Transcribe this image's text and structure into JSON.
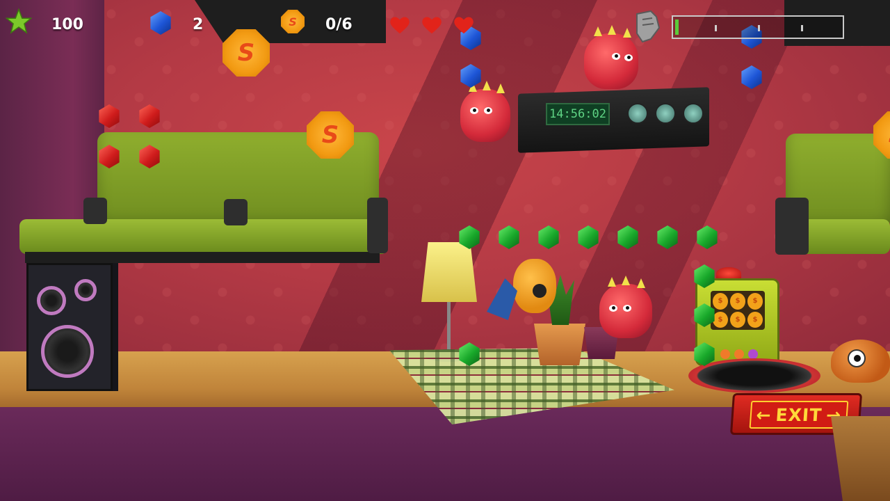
{
  "hud": {
    "score": "100",
    "blue_gems": "2",
    "coins": "0/6",
    "hearts": 3,
    "level_progress": 0.02
  },
  "device": {
    "clock_display": "14:56:02"
  },
  "exit": {
    "label": "EXIT",
    "arrow_left": "←",
    "arrow_right": "→"
  },
  "coin_symbol": "S",
  "slot_symbol": "$",
  "colors": {
    "gem_red": "#d01c1c",
    "gem_green": "#18a82a",
    "gem_blue": "#1d55d6",
    "coin": "#f29a12",
    "exit": "#d11c14",
    "progress_fill": "#5acb3a"
  },
  "icons": {
    "score": "star-icon",
    "gems": "blue-gem-icon",
    "coins": "coin-icon",
    "lives": "heart-icon",
    "power": "gauntlet-icon"
  }
}
